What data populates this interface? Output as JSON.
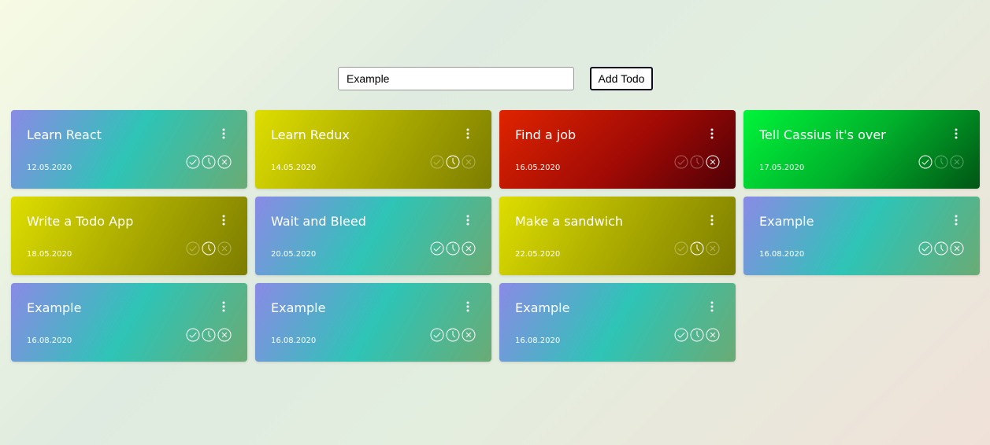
{
  "input": {
    "value": "Example"
  },
  "add_button": {
    "label": "Add Todo"
  },
  "icons": {
    "menu": "vertical-dots-icon",
    "done": "check-circle-icon",
    "pending": "clock-icon",
    "cancel": "close-circle-icon"
  },
  "colors": {
    "default": "blue-teal gradient",
    "pending": "yellow-olive gradient",
    "cancelled": "red gradient",
    "done": "green gradient"
  },
  "todos": [
    {
      "title": "Learn React",
      "date": "12.05.2020",
      "status": "default"
    },
    {
      "title": "Learn Redux",
      "date": "14.05.2020",
      "status": "pending"
    },
    {
      "title": "Find a job",
      "date": "16.05.2020",
      "status": "cancelled"
    },
    {
      "title": "Tell Cassius it's over",
      "date": "17.05.2020",
      "status": "done"
    },
    {
      "title": "Write a Todo App",
      "date": "18.05.2020",
      "status": "pending"
    },
    {
      "title": "Wait and Bleed",
      "date": "20.05.2020",
      "status": "default"
    },
    {
      "title": "Make a sandwich",
      "date": "22.05.2020",
      "status": "pending"
    },
    {
      "title": "Example",
      "date": "16.08.2020",
      "status": "default"
    },
    {
      "title": "Example",
      "date": "16.08.2020",
      "status": "default"
    },
    {
      "title": "Example",
      "date": "16.08.2020",
      "status": "default"
    },
    {
      "title": "Example",
      "date": "16.08.2020",
      "status": "default"
    }
  ]
}
